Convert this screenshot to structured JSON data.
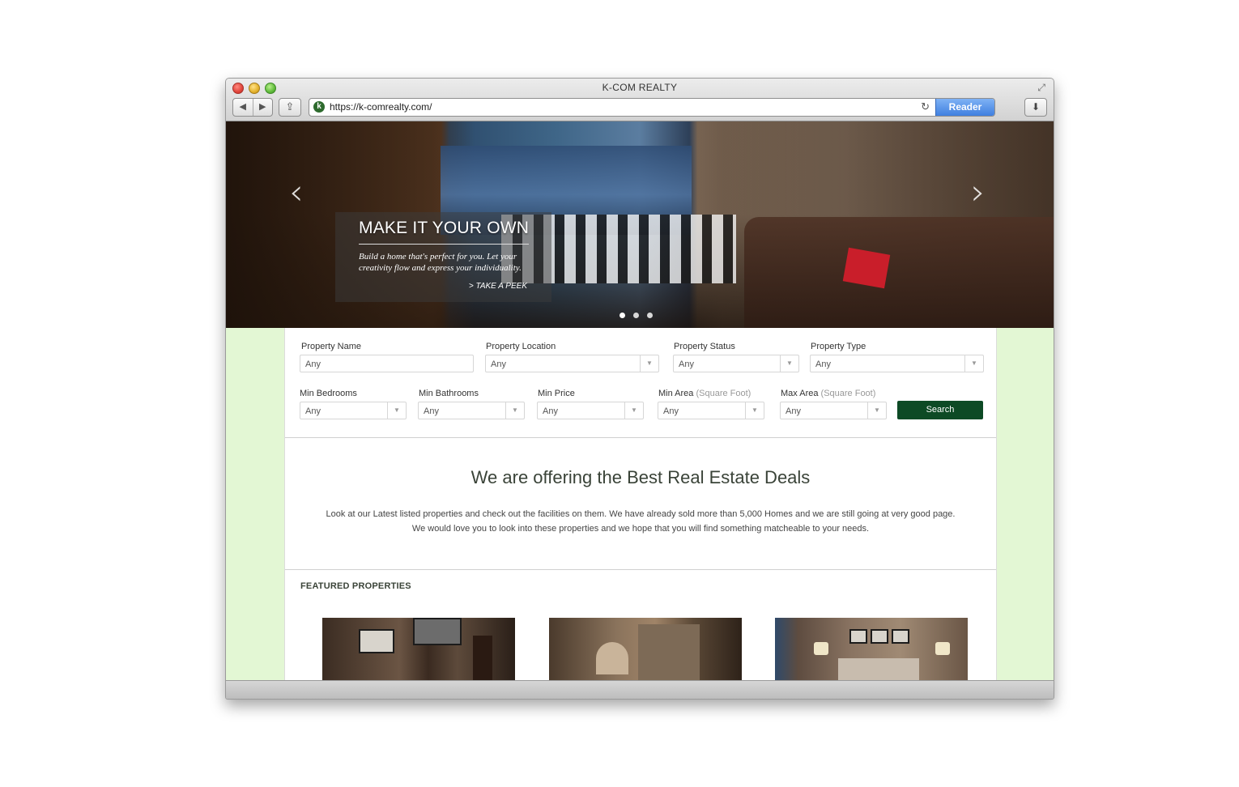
{
  "window": {
    "title": "K-COM REALTY",
    "url": "https://k-comrealty.com/",
    "reader_label": "Reader",
    "favicon_letter": "k"
  },
  "hero": {
    "title": "MAKE IT YOUR OWN",
    "text": "Build a home that's perfect for you. Let your creativity flow and express your individuality.",
    "link_label": "> TAKE A PEEK",
    "prev_icon": "‹",
    "next_icon": "›",
    "slide_count": 3,
    "active_slide": 1
  },
  "search": {
    "fields": {
      "property_name": {
        "label": "Property Name",
        "value": "Any"
      },
      "property_location": {
        "label": "Property Location",
        "value": "Any"
      },
      "property_status": {
        "label": "Property Status",
        "value": "Any"
      },
      "property_type": {
        "label": "Property Type",
        "value": "Any"
      },
      "min_bedrooms": {
        "label": "Min Bedrooms",
        "value": "Any"
      },
      "min_bathrooms": {
        "label": "Min Bathrooms",
        "value": "Any"
      },
      "min_price": {
        "label": "Min Price",
        "value": "Any"
      },
      "min_area": {
        "label": "Min Area",
        "hint": "(Square Foot)",
        "value": "Any"
      },
      "max_area": {
        "label": "Max Area",
        "hint": "(Square Foot)",
        "value": "Any"
      }
    },
    "button_label": "Search"
  },
  "intro": {
    "headline": "We are offering the Best Real Estate Deals",
    "line1": "Look at our Latest listed properties and check out the facilities on them. We have already sold more than 5,000 Homes and we are still going at very good page.",
    "line2": "We would love you to look into these properties and we hope that you will find something matcheable to your needs."
  },
  "featured": {
    "title": "FEATURED PROPERTIES"
  },
  "colors": {
    "accent": "#0d4a25",
    "page_background": "#e3f7d4",
    "reader_blue": "#3f7fe0"
  }
}
